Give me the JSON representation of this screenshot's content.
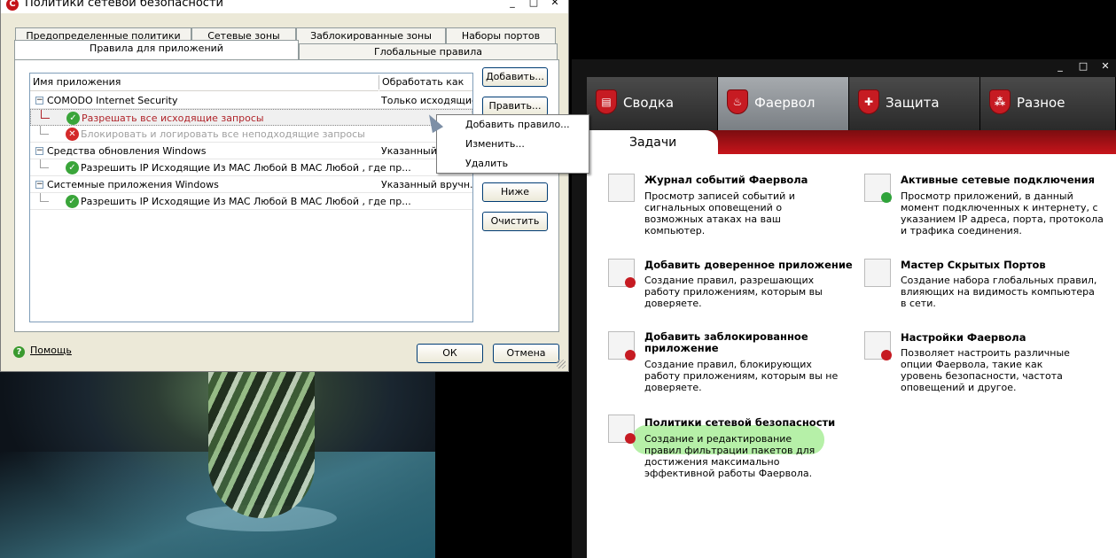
{
  "dialog": {
    "title": "Политики сетевой безопасности",
    "tabs_row1": [
      "Предопределенные политики",
      "Сетевые зоны",
      "Заблокированные зоны",
      "Наборы портов"
    ],
    "tabs_row2": [
      "Правила для приложений",
      "Глобальные правила"
    ],
    "active_tab": "Правила для приложений",
    "columns": [
      "Имя приложения",
      "Обработать как"
    ],
    "rows": [
      {
        "type": "app",
        "name": "COMODO Internet Security",
        "treat_as": "Только исходящие"
      },
      {
        "type": "rule",
        "icon": "allow",
        "name": "Разрешать все исходящие запросы",
        "treat_as": ""
      },
      {
        "type": "rule",
        "icon": "block",
        "name": "Блокировать и логировать все неподходящие запросы",
        "treat_as": ""
      },
      {
        "type": "app",
        "name": "Средства обновления Windows",
        "treat_as": "Указанный в"
      },
      {
        "type": "rule",
        "icon": "allow",
        "name": "Разрешить IP Исходящие Из MAC Любой В MAC Любой , где пр...",
        "treat_as": ""
      },
      {
        "type": "app",
        "name": "Системные приложения Windows",
        "treat_as": "Указанный вручн..."
      },
      {
        "type": "rule",
        "icon": "allow",
        "name": "Разрешить IP Исходящие Из MAC Любой В MAC Любой , где пр...",
        "treat_as": ""
      }
    ],
    "buttons": {
      "add": "Добавить...",
      "edit": "Править...",
      "down": "Ниже",
      "clear": "Очистить",
      "ok": "ОК",
      "cancel": "Отмена"
    },
    "help": "Помощь"
  },
  "context_menu": [
    "Добавить правило...",
    "Изменить...",
    "Удалить"
  ],
  "main": {
    "nav": [
      "Сводка",
      "Фаервол",
      "Защита",
      "Разное"
    ],
    "active_nav": "Фаервол",
    "tasks_label": "Задачи",
    "tasks": [
      {
        "title": "Журнал событий Фаервола",
        "desc": "Просмотр записей событий и сигнальных оповещений о возможных атаках на ваш компьютер.",
        "icon": "log-icon"
      },
      {
        "title": "Активные сетевые подключения",
        "desc": "Просмотр приложений, в данный момент подключенных к интернету, с указанием IP адреса, порта, протокола и трафика соединения.",
        "icon": "connections-icon"
      },
      {
        "title": "Добавить доверенное приложение",
        "desc": "Создание правил, разрешающих работу приложениям, которым вы доверяете.",
        "icon": "trusted-app-icon"
      },
      {
        "title": "Мастер Скрытых Портов",
        "desc": "Создание набора глобальных правил, влияющих на видимость компьютера в сети.",
        "icon": "stealth-ports-icon"
      },
      {
        "title": "Добавить заблокированное приложение",
        "desc": "Создание правил, блокирующих работу приложениям, которым вы не доверяете.",
        "icon": "blocked-app-icon"
      },
      {
        "title": "Настройки Фаервола",
        "desc": "Позволяет настроить различные опции Фаервола, такие как уровень безопасности, частота оповещений и другое.",
        "icon": "settings-icon"
      },
      {
        "title": "Политики сетевой безопасности",
        "desc": "Создание и редактирование правил фильтрации пакетов для достижения максимально эффективной работы Фаервола.",
        "icon": "policy-icon"
      }
    ]
  },
  "colors": {
    "accent_red": "#c7141b",
    "highlight_green": "#b6f0a8",
    "allow_green": "#3aa53a"
  }
}
